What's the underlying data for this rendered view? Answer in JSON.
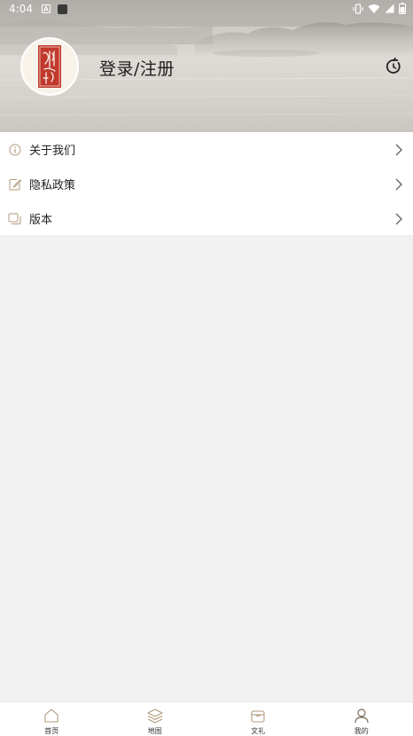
{
  "status_bar": {
    "time": "4:04",
    "left_icons": [
      "a-icon",
      "app-icon"
    ],
    "right_icons": [
      "vibrate-icon",
      "wifi-icon",
      "signal-icon",
      "battery-icon"
    ]
  },
  "profile": {
    "login_label": "登录/注册",
    "avatar_icon": "seal-logo",
    "refresh_icon": "refresh-icon"
  },
  "menu": {
    "items": [
      {
        "label": "关于我们",
        "icon": "info-icon"
      },
      {
        "label": "隐私政策",
        "icon": "edit-icon"
      },
      {
        "label": "版本",
        "icon": "version-icon"
      }
    ]
  },
  "bottom_nav": {
    "items": [
      {
        "label": "首页",
        "icon": "home-icon"
      },
      {
        "label": "地图",
        "icon": "layers-icon"
      },
      {
        "label": "文礼",
        "icon": "shop-icon"
      },
      {
        "label": "我的",
        "icon": "user-icon"
      }
    ],
    "active_index": 3
  },
  "colors": {
    "accent": "#b39a7c",
    "background": "#f1f1f1",
    "seal_red": "#c0392b"
  }
}
